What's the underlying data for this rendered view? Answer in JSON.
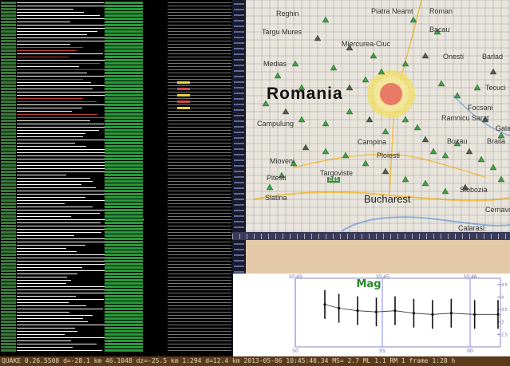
{
  "map": {
    "country": "Romania",
    "cities": [
      "Reghin",
      "Piatra Neamt",
      "Roman",
      "Bacau",
      "Targu Mures",
      "Miercurea-Ciuc",
      "Onesti",
      "Barlad",
      "Medias",
      "Tecuci",
      "Focsani",
      "Ramnicu Sarat",
      "Galati",
      "Braila",
      "Campulung",
      "Campina",
      "Buzau",
      "Ploiesti",
      "Mioveni",
      "Targoviste",
      "Pitesti",
      "Slobozia",
      "Slatina",
      "Bucharest",
      "Cernavoda",
      "Calarasi"
    ],
    "road_label": "E85",
    "colors": {
      "land": "#e9e5dc",
      "grid": "#5a6a8a",
      "station": "#3aa040",
      "event_outer": "#f1e05a",
      "event_inner": "#e55555"
    }
  },
  "mag_chart": {
    "title": "Mag",
    "top_time_labels": [
      "10:45",
      "10:45",
      "10:46"
    ],
    "bottom_labels": [
      "50",
      "55",
      "00"
    ],
    "right_ticks": [
      "4.5",
      "4",
      "3.5",
      "3",
      "2.5"
    ]
  },
  "chart_data": {
    "type": "scatter",
    "title": "Mag",
    "x_top_ticks": [
      "10:45",
      "10:45",
      "10:46"
    ],
    "x_bottom_ticks": [
      "50",
      "55",
      "00"
    ],
    "y_ticks": [
      4.5,
      4,
      3.5,
      3,
      2.5
    ],
    "ylim": [
      2.0,
      4.75
    ],
    "series": [
      {
        "x": [
          45.0,
          46.5,
          48.5,
          50.5,
          52.5,
          54.5,
          56.5,
          58.5,
          61.0,
          63.5
        ],
        "y": [
          3.7,
          3.55,
          3.45,
          3.4,
          3.45,
          3.35,
          3.3,
          3.35,
          3.3,
          3.3
        ]
      }
    ]
  },
  "status": {
    "text": "QUAKE 0.26.5508 d=-28.1 km 46.1048 dz=-25.5 km 1:294 d=12.4 km 2013-05-06 10:45:40.34 MS= 2.7 ML 1.1 RM 1 frame 1:28 h"
  }
}
